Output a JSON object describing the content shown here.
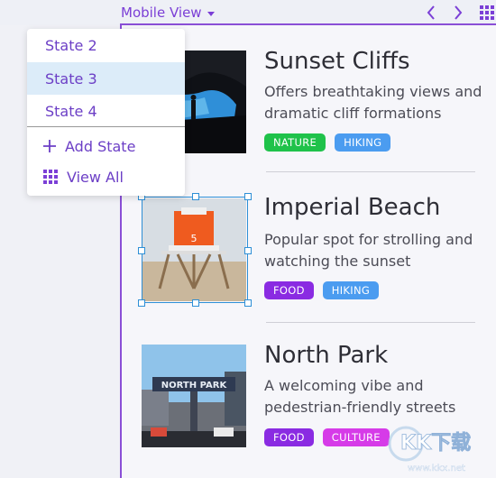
{
  "toolbar": {
    "view_label": "Mobile View",
    "prev_icon": "chevron-left-icon",
    "next_icon": "chevron-right-icon",
    "grid_icon": "grid-icon"
  },
  "dropdown": {
    "items": [
      {
        "label": "State 2",
        "selected": false
      },
      {
        "label": "State 3",
        "selected": true
      },
      {
        "label": "State 4",
        "selected": false
      }
    ],
    "add_label": "Add State",
    "view_all_label": "View All"
  },
  "cards": [
    {
      "title": "Sunset Cliffs",
      "description": "Offers breathtaking views and dramatic cliff formations",
      "tags": [
        {
          "label": "NATURE",
          "color": "#1fc24a"
        },
        {
          "label": "HIKING",
          "color": "#4b9cf0"
        }
      ]
    },
    {
      "title": "Imperial Beach",
      "description": "Popular spot for strolling and watching the sunset",
      "tags": [
        {
          "label": "FOOD",
          "color": "#8a2be2"
        },
        {
          "label": "HIKING",
          "color": "#4b9cf0"
        }
      ],
      "image_label": "5"
    },
    {
      "title": "North Park",
      "description": "A welcoming vibe and pedestrian-friendly streets",
      "tags": [
        {
          "label": "FOOD",
          "color": "#8a2be2"
        },
        {
          "label": "CULTURE",
          "color": "#d63be8"
        }
      ],
      "image_label": "NORTH PARK"
    }
  ],
  "colors": {
    "accent": "#7b3fd6",
    "selection": "#2e8fd6",
    "dropdown_selected_bg": "#dcecf9"
  },
  "watermark": {
    "brand": "KK下载",
    "url": "www.kkx.net"
  }
}
